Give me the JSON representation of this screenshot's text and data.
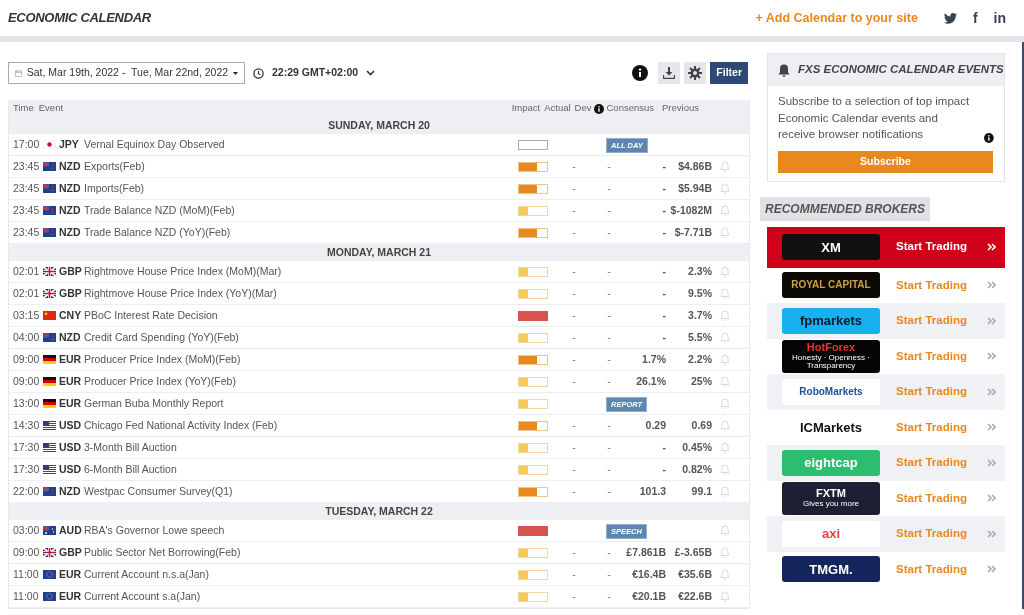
{
  "header": {
    "title": "ECONOMIC CALENDAR",
    "add_link": "+ Add Calendar to your site",
    "social": [
      {
        "kind": "twitter"
      },
      {
        "kind": "facebook",
        "glyph": "f"
      },
      {
        "kind": "linkedin",
        "glyph": "in"
      }
    ]
  },
  "toolbar": {
    "date_range": "Sat, Mar 19th, 2022 -  Tue, Mar 22nd, 2022",
    "time": "22:29 GMT+02:00",
    "filter_button": "Filter"
  },
  "table": {
    "columns": [
      "Time",
      "Event",
      "Impact",
      "Actual",
      "Dev",
      "Consensus",
      "Previous"
    ],
    "days": [
      {
        "label": "SUNDAY, MARCH 20",
        "rows": [
          {
            "time": "17:00",
            "flag": {
              "kind": "jp"
            },
            "currency": "JPY",
            "event": "Vernal Equinox Day Observed",
            "level": 0,
            "tag": "ALL DAY",
            "bell": false
          },
          {
            "time": "23:45",
            "flag": {
              "kind": "nz"
            },
            "currency": "NZD",
            "event": "Exports(Feb)",
            "level": 0.66,
            "actual": "-",
            "dev": "-",
            "consensus": "-",
            "previous": "$4.86B",
            "bell": true
          },
          {
            "time": "23:45",
            "flag": {
              "kind": "nz"
            },
            "currency": "NZD",
            "event": "Imports(Feb)",
            "level": 0.66,
            "actual": "-",
            "dev": "-",
            "consensus": "-",
            "previous": "$5.94B",
            "bell": true
          },
          {
            "time": "23:45",
            "flag": {
              "kind": "nz"
            },
            "currency": "NZD",
            "event": "Trade Balance NZD (MoM)(Feb)",
            "level": 0.33,
            "actual": "-",
            "dev": "-",
            "consensus": "-",
            "previous": "$-1082M",
            "bell": true
          },
          {
            "time": "23:45",
            "flag": {
              "kind": "nz"
            },
            "currency": "NZD",
            "event": "Trade Balance NZD (YoY)(Feb)",
            "level": 0.66,
            "actual": "-",
            "dev": "-",
            "consensus": "-",
            "previous": "$-7.71B",
            "bell": true
          }
        ]
      },
      {
        "label": "MONDAY, MARCH 21",
        "rows": [
          {
            "time": "02:01",
            "flag": {
              "kind": "gb"
            },
            "currency": "GBP",
            "event": "Rightmove House Price Index (MoM)(Mar)",
            "level": 0.33,
            "actual": "-",
            "dev": "-",
            "consensus": "-",
            "previous": "2.3%",
            "bell": true
          },
          {
            "time": "02:01",
            "flag": {
              "kind": "gb"
            },
            "currency": "GBP",
            "event": "Rightmove House Price Index (YoY)(Mar)",
            "level": 0.33,
            "actual": "-",
            "dev": "-",
            "consensus": "-",
            "previous": "9.5%",
            "bell": true
          },
          {
            "time": "03:15",
            "flag": {
              "kind": "cn"
            },
            "currency": "CNY",
            "event": "PBoC Interest Rate Decision",
            "level": 1,
            "actual": "-",
            "dev": "-",
            "consensus": "-",
            "previous": "3.7%",
            "bell": true
          },
          {
            "time": "04:00",
            "flag": {
              "kind": "nz"
            },
            "currency": "NZD",
            "event": "Credit Card Spending (YoY)(Feb)",
            "level": 0.33,
            "actual": "-",
            "dev": "-",
            "consensus": "-",
            "previous": "5.5%",
            "bell": true
          },
          {
            "time": "09:00",
            "flag": {
              "kind": "de"
            },
            "currency": "EUR",
            "event": "Producer Price Index (MoM)(Feb)",
            "level": 0.66,
            "actual": "-",
            "dev": "-",
            "consensus": "1.7%",
            "previous": "2.2%",
            "bell": true
          },
          {
            "time": "09:00",
            "flag": {
              "kind": "de"
            },
            "currency": "EUR",
            "event": "Producer Price Index (YoY)(Feb)",
            "level": 0.33,
            "actual": "-",
            "dev": "-",
            "consensus": "26.1%",
            "previous": "25%",
            "bell": true
          },
          {
            "time": "13:00",
            "flag": {
              "kind": "de"
            },
            "currency": "EUR",
            "event": "German Buba Monthly Report",
            "level": 0.33,
            "tag": "REPORT",
            "bell": true
          },
          {
            "time": "14:30",
            "flag": {
              "kind": "us"
            },
            "currency": "USD",
            "event": "Chicago Fed National Activity Index (Feb)",
            "level": 0.66,
            "actual": "-",
            "dev": "-",
            "consensus": "0.29",
            "previous": "0.69",
            "bell": true
          },
          {
            "time": "17:30",
            "flag": {
              "kind": "us"
            },
            "currency": "USD",
            "event": "3-Month Bill Auction",
            "level": 0.33,
            "actual": "-",
            "dev": "-",
            "consensus": "-",
            "previous": "0.45%",
            "bell": true
          },
          {
            "time": "17:30",
            "flag": {
              "kind": "us"
            },
            "currency": "USD",
            "event": "6-Month Bill Auction",
            "level": 0.33,
            "actual": "-",
            "dev": "-",
            "consensus": "-",
            "previous": "0.82%",
            "bell": true
          },
          {
            "time": "22:00",
            "flag": {
              "kind": "nz"
            },
            "currency": "NZD",
            "event": "Westpac Consumer Survey(Q1)",
            "level": 0.66,
            "actual": "-",
            "dev": "-",
            "consensus": "101.3",
            "previous": "99.1",
            "bell": true
          }
        ]
      },
      {
        "label": "TUESDAY, MARCH 22",
        "rows": [
          {
            "time": "03:00",
            "flag": {
              "kind": "au"
            },
            "currency": "AUD",
            "event": "RBA's Governor Lowe speech",
            "level": 1,
            "tag": "SPEECH",
            "bell": true
          },
          {
            "time": "09:00",
            "flag": {
              "kind": "gb"
            },
            "currency": "GBP",
            "event": "Public Sector Net Borrowing(Feb)",
            "level": 0.33,
            "actual": "-",
            "dev": "-",
            "consensus": "£7.861B",
            "previous": "£-3.65B",
            "bell": true
          },
          {
            "time": "11:00",
            "flag": {
              "kind": "eu"
            },
            "currency": "EUR",
            "event": "Current Account n.s.a(Jan)",
            "level": 0.33,
            "actual": "-",
            "dev": "-",
            "consensus": "€16.4B",
            "previous": "€35.6B",
            "bell": true
          },
          {
            "time": "11:00",
            "flag": {
              "kind": "eu"
            },
            "currency": "EUR",
            "event": "Current Account s.a(Jan)",
            "level": 0.33,
            "actual": "-",
            "dev": "-",
            "consensus": "€20.1B",
            "previous": "€22.6B",
            "bell": true
          }
        ]
      }
    ]
  },
  "events_box": {
    "title": "FXS ECONOMIC CALENDAR EVENTS",
    "text": "Subscribe to a selection of top impact Economic Calendar events and receive browser notifications",
    "button": "Subscribe"
  },
  "brokers": {
    "title": "RECOMMENDED BROKERS",
    "items": [
      {
        "logo": {
          "name": "XM",
          "color": "#ffffff"
        },
        "color": "#111111",
        "featured": true,
        "action": "Start Trading"
      },
      {
        "logo": {
          "name": "ROYAL CAPITAL",
          "color": "#c9a23a"
        },
        "color": "#0d0a05",
        "featured": false,
        "action": "Start Trading"
      },
      {
        "logo": {
          "name": "fpmarkets",
          "color": "#0a1a2a"
        },
        "color": "#17b1ef",
        "featured": false,
        "action": "Start Trading"
      },
      {
        "logo": {
          "name": "HotForex",
          "color": "#e8362c"
        },
        "tagline": "Honesty · Openness · Transparency",
        "color": "#050505",
        "featured": false,
        "action": "Start Trading"
      },
      {
        "logo": {
          "name": "RoboMarkets",
          "color": "#1f4f9a"
        },
        "color": "#ffffff",
        "featured": false,
        "action": "Start Trading"
      },
      {
        "logo": {
          "name": "ICMarkets",
          "color": "#111111"
        },
        "color": "#ffffff",
        "featured": false,
        "action": "Start Trading"
      },
      {
        "logo": {
          "name": "eightcap",
          "color": "#ffffff"
        },
        "color": "#2dbd6e",
        "featured": false,
        "action": "Start Trading"
      },
      {
        "logo": {
          "name": "FXTM",
          "color": "#ffffff"
        },
        "tagline": "Gives you more",
        "color": "#1d1f33",
        "featured": false,
        "action": "Start Trading"
      },
      {
        "logo": {
          "name": "axi",
          "color": "#ef3a4a"
        },
        "color": "#ffffff",
        "featured": false,
        "action": "Start Trading"
      },
      {
        "logo": {
          "name": "TMGM.",
          "color": "#ffffff"
        },
        "color": "#13255a",
        "featured": false,
        "action": "Start Trading"
      }
    ]
  }
}
